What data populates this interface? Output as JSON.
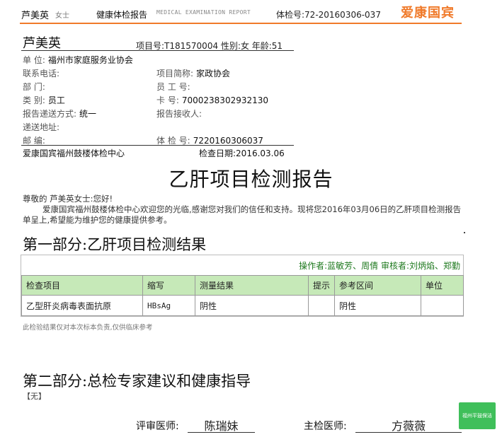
{
  "header": {
    "patient_name": "芦美英",
    "title_suffix": "女士",
    "report_title": "健康体检报告",
    "report_title_en": "MEDICAL EXAMINATION REPORT",
    "exam_no": "体检号:72-20160306-037",
    "brand": "爱康国宾"
  },
  "patient": {
    "name": "芦美英",
    "project_line": "项目号:T181570004  性别:女  年龄:51",
    "fields": [
      {
        "label": "单    位:",
        "value": "福州市家庭服务业协会"
      },
      {
        "label": "联系电话:",
        "value": ""
      },
      {
        "label": "项目简称:",
        "value": "家政协会"
      },
      {
        "label": "部    门:",
        "value": ""
      },
      {
        "label": "员 工 号:",
        "value": ""
      },
      {
        "label": "类    别:",
        "value": "员工"
      },
      {
        "label": "卡      号:",
        "value": "7000238302932130"
      },
      {
        "label": "报告递送方式:",
        "value": "统一"
      },
      {
        "label": "报告接收人:",
        "value": ""
      },
      {
        "label": "递送地址:",
        "value": ""
      },
      {
        "label": "邮      编:",
        "value": ""
      },
      {
        "label": "体 检 号:",
        "value": "7220160306037"
      }
    ],
    "center": "爱康国宾福州鼓楼体检中心",
    "exam_date": "检查日期:2016.03.06"
  },
  "report": {
    "title": "乙肝项目检测报告",
    "greeting": "尊敬的 芦美英女士:您好!",
    "paragraph": "爱康国宾福州鼓楼体检中心欢迎您的光临,感谢您对我们的信任和支持。现将您2016年03月06日的乙肝项目检测报告单呈上,希望能为维护您的健康提供参考。"
  },
  "section1": {
    "title": "第一部分:乙肝项目检测结果",
    "operators": "操作者:蓝敏芳、周倩   审核者:刘炳焰、郑勤",
    "columns": [
      "检查项目",
      "缩写",
      "测量结果",
      "提示",
      "参考区间",
      "单位"
    ],
    "rows": [
      [
        "乙型肝炎病毒表面抗原",
        "HBsAg",
        "阴性",
        "",
        "阴性",
        ""
      ]
    ],
    "note": "此检验结果仅对本次标本负责,仅供临床参考"
  },
  "section2": {
    "title": "第二部分:总检专家建议和健康指导",
    "content": "【无】"
  },
  "signatures": {
    "reviewer_label": "评审医师:",
    "reviewer_name": "陈瑞妹",
    "chief_label": "主检医师:",
    "chief_name": "方薇薇"
  },
  "badge": {
    "text": "福州平鼓保洁"
  },
  "colors": {
    "brand_orange": "#f07a2a",
    "table_header_green": "#c6e9b8",
    "operator_green": "#1f7a1f",
    "badge_green": "#3fbf5a"
  }
}
